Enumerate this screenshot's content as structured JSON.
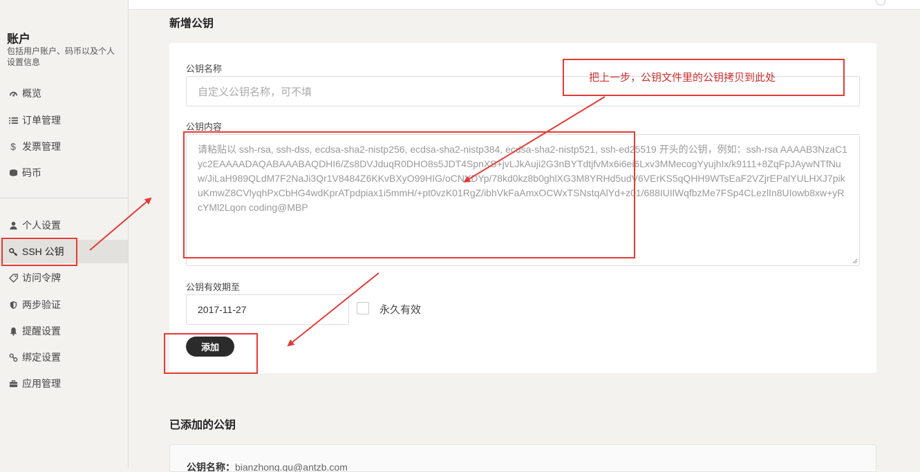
{
  "sidebar": {
    "title": "账户",
    "description": "包括用户账户、码币以及个人设置信息",
    "items": [
      {
        "label": "概览",
        "icon": "dashboard-icon"
      },
      {
        "label": "订单管理",
        "icon": "list-icon"
      },
      {
        "label": "发票管理",
        "icon": "dollar-icon"
      },
      {
        "label": "码币",
        "icon": "coins-icon"
      },
      {
        "label": "个人设置",
        "icon": "user-icon"
      },
      {
        "label": "SSH 公钥",
        "icon": "key-icon",
        "active": true
      },
      {
        "label": "访问令牌",
        "icon": "tag-icon"
      },
      {
        "label": "两步验证",
        "icon": "shield-icon"
      },
      {
        "label": "提醒设置",
        "icon": "bell-icon"
      },
      {
        "label": "绑定设置",
        "icon": "link-icon"
      },
      {
        "label": "应用管理",
        "icon": "briefcase-icon"
      }
    ]
  },
  "form": {
    "heading": "新增公钥",
    "name_label": "公钥名称",
    "name_placeholder": "自定义公钥名称，可不填",
    "content_label": "公钥内容",
    "content_placeholder": "请粘贴以 ssh-rsa, ssh-dss, ecdsa-sha2-nistp256, ecdsa-sha2-nistp384, ecdsa-sha2-nistp521, ssh-ed25519 开头的公钥，例如：ssh-rsa AAAAB3NzaC1yc2EAAAADAQABAAABAQDHI6/Zs8DVJduqR0DHO8s5JDT4SpnXS+jvLJkAuji2G3nBYTdtjfvMx6i6ei6Lxv3MMecogYyujhIx/k9111+8ZqFpJAywNTfNuw/JiLaH989QLdM7F2NaJi3Qr1V8484Z6KKvBXyO99HIG/oCNYDYp/78kd0kz8b0ghlXG3M8YRHd5udV6VErKS5qQHH9WTsEaF2VZjrEPalYULHXJ7pikuKmwZ8CVlyqhPxCbHG4wdKprATpdpiax1i5mmH/+pt0vzK01RgZ/ibhVkFaAmxOCWxTSNstqAlYd+z01/688IUIlWqfbzMe7FSp4CLezlIn8UIowb8xw+yRcYMl2Lqon coding@MBP",
    "expiry_label": "公钥有效期至",
    "expiry_value": "2017-11-27",
    "permanent_label": "永久有效",
    "add_button": "添加"
  },
  "added": {
    "heading": "已添加的公钥",
    "name_key": "公钥名称：",
    "name_value": "bianzhong.gu@antzb.com"
  },
  "annotation": {
    "callout_text": "把上一步，公钥文件里的公钥拷贝到此处",
    "color": "#e53935"
  }
}
